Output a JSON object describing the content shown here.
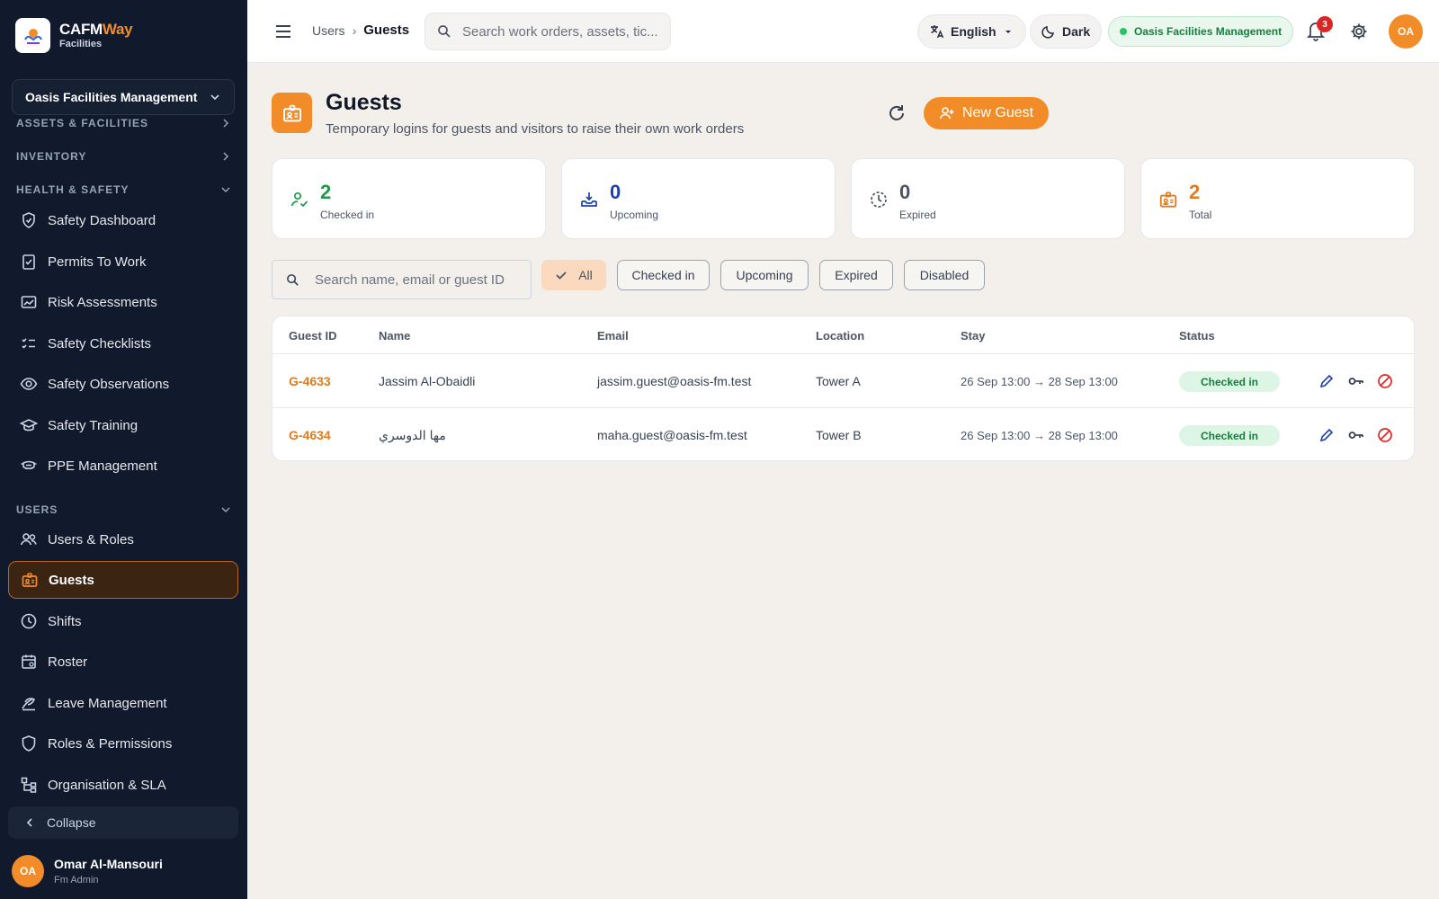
{
  "brand": {
    "name_main": "CAFM",
    "name_accent": "Way",
    "sub": "Facilities"
  },
  "org_selector": {
    "value": "Oasis Facilities Management"
  },
  "sidebar": {
    "sections": {
      "assets": "ASSETS & FACILITIES",
      "inventory": "INVENTORY",
      "health": "HEALTH & SAFETY",
      "users": "USERS"
    },
    "health_items": [
      {
        "label": "Safety Dashboard",
        "icon": "shield-check-icon"
      },
      {
        "label": "Permits To Work",
        "icon": "clipboard-check-icon"
      },
      {
        "label": "Risk Assessments",
        "icon": "chart-card-icon"
      },
      {
        "label": "Safety Checklists",
        "icon": "checklist-icon"
      },
      {
        "label": "Safety Observations",
        "icon": "eye-icon"
      },
      {
        "label": "Safety Training",
        "icon": "graduation-cap-icon"
      },
      {
        "label": "PPE Management",
        "icon": "mask-icon"
      }
    ],
    "user_items": [
      {
        "label": "Users & Roles",
        "icon": "users-icon"
      },
      {
        "label": "Guests",
        "icon": "badge-icon",
        "active": true
      },
      {
        "label": "Shifts",
        "icon": "clock-icon"
      },
      {
        "label": "Roster",
        "icon": "calendar-icon"
      },
      {
        "label": "Leave Management",
        "icon": "leave-icon"
      },
      {
        "label": "Roles & Permissions",
        "icon": "shield-icon"
      },
      {
        "label": "Organisation & SLA",
        "icon": "org-chart-icon"
      }
    ],
    "collapse": "Collapse",
    "user": {
      "initials": "OA",
      "name": "Omar Al-Mansouri",
      "role": "Fm Admin"
    }
  },
  "topbar": {
    "breadcrumb": [
      "Users",
      "Guests"
    ],
    "search_placeholder": "Search work orders, assets, tic...",
    "language": "English",
    "theme": "Dark",
    "org": "Oasis Facilities Management",
    "notifications": "3",
    "avatar": "OA"
  },
  "page": {
    "title": "Guests",
    "subtitle": "Temporary logins for guests and visitors to raise their own work orders",
    "new_button": "New Guest"
  },
  "stats": [
    {
      "value": "2",
      "label": "Checked in",
      "color": "#1f9a4b"
    },
    {
      "value": "0",
      "label": "Upcoming",
      "color": "#1e40af"
    },
    {
      "value": "0",
      "label": "Expired",
      "color": "#4b5563"
    },
    {
      "value": "2",
      "label": "Total",
      "color": "#e07b1e"
    }
  ],
  "filters": {
    "search_placeholder": "Search name, email or guest ID",
    "chips": [
      "All",
      "Checked in",
      "Upcoming",
      "Expired",
      "Disabled"
    ],
    "selected": "All"
  },
  "table": {
    "columns": [
      "Guest ID",
      "Name",
      "Email",
      "Location",
      "Stay",
      "Status"
    ],
    "rows": [
      {
        "id": "G-4633",
        "name": "Jassim Al-Obaidli",
        "email": "jassim.guest@oasis-fm.test",
        "location": "Tower A",
        "stay": "26 Sep 13:00 → 28 Sep 13:00",
        "status": "Checked in"
      },
      {
        "id": "G-4634",
        "name": "مها الدوسري",
        "email": "maha.guest@oasis-fm.test",
        "location": "Tower B",
        "stay": "26 Sep 13:00 → 28 Sep 13:00",
        "status": "Checked in"
      }
    ]
  },
  "colors": {
    "accent": "#f28c28",
    "sidebar_bg": "#111a2c",
    "success": "#15803d"
  }
}
